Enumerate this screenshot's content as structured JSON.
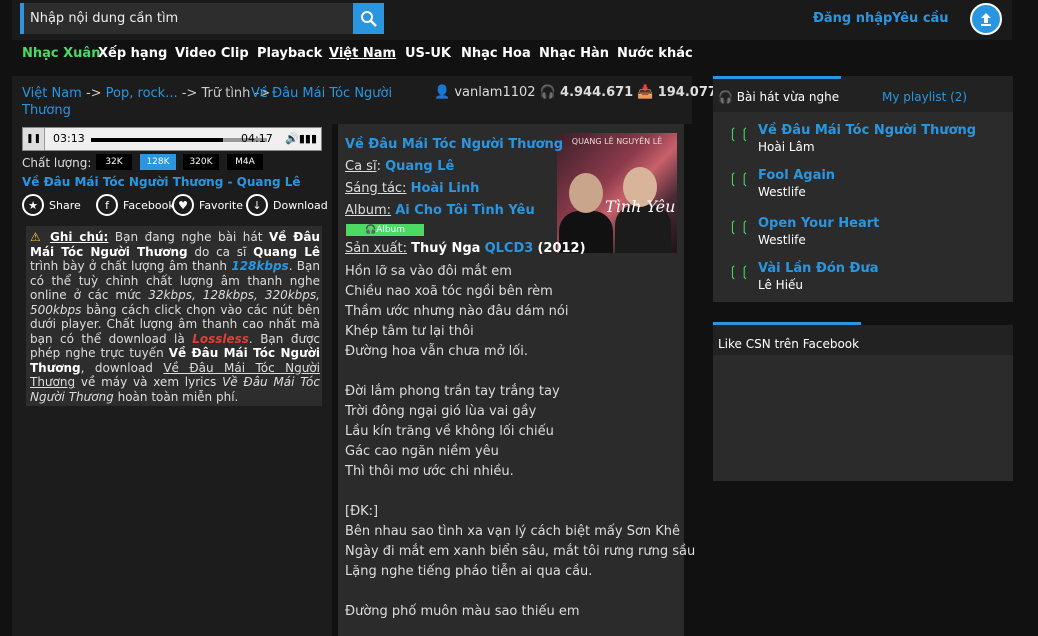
{
  "search": {
    "placeholder": "Nhập nội dung cần tìm"
  },
  "header": {
    "login": "Đăng nhập",
    "signup": "Yêu cầu"
  },
  "nav": [
    {
      "label": "Nhạc Xuân"
    },
    {
      "label": "Xếp hạng"
    },
    {
      "label": "Video Clip"
    },
    {
      "label": "Playback"
    },
    {
      "label": "Việt Nam"
    },
    {
      "label": "US-UK"
    },
    {
      "label": "Nhạc Hoa"
    },
    {
      "label": "Nhạc Hàn"
    },
    {
      "label": "Nước khác"
    }
  ],
  "breadcrumb": {
    "root": "Việt Nam",
    "sep": " -> ",
    "genre": "Pop, rock...",
    "sub": "Trữ tình",
    "song": "Về Đâu Mái Tóc Người Thương"
  },
  "stats": {
    "uploader": "vanlam1102",
    "listens": "4.944.671",
    "downloads": "194.077"
  },
  "player": {
    "current": "03:13",
    "duration": "04:17",
    "progress": 0.75
  },
  "quality": {
    "label": "Chất lượng:",
    "options": [
      "32K",
      "128K",
      "320K",
      "M4A"
    ]
  },
  "song_title_link": "Về Đâu Mái Tóc Người Thương - Quang Lê",
  "share": {
    "share": "Share",
    "facebook": "Facebook",
    "favorite": "Favorite",
    "download": "Download"
  },
  "note": {
    "heading": "Ghi chú:",
    "t1": " Bạn đang nghe bài hát ",
    "song": "Về Đâu Mái Tóc Người Thương",
    "t2": " do ca sĩ ",
    "artist": "Quang Lê",
    "t3": " trình bày ở chất lượng âm thanh ",
    "kbps": "128kbps",
    "t4": ". Bạn có thể tuỳ chỉnh chất lượng âm thanh nghe online ở các mức ",
    "levels": "32kbps, 128kbps, 320kbps, 500kbps",
    "t5": " bằng cách click chọn vào các nút bên dưới player. Chất lượng âm thanh cao nhất mà bạn có thể download là ",
    "lossless": "Lossless",
    "t6": ". Bạn được phép nghe trực tuyến ",
    "song2": "Về Đâu Mái Tóc Người Thương",
    "t7": ", download ",
    "song3": "Về Đâu Mái Tóc Người Thương",
    "t8": " về máy và xem lyrics ",
    "song4": "Về Đâu Mái Tóc Người Thương",
    "t9": " hoàn toàn miễn phí."
  },
  "meta": {
    "title": "Về Đâu Mái Tóc Người Thương",
    "singer_label": "Ca sĩ",
    "singer": "Quang Lê",
    "composer_label": "Sáng tác:",
    "composer": "Hoài Linh",
    "album_label": "Album:",
    "album": "Ai Cho Tôi Tình Yêu",
    "album_badge": "Album",
    "producer_label": "Sản xuất:",
    "producer": "Thuý Nga",
    "code": "QLCD3",
    "year": "(2012)"
  },
  "album_art": {
    "caption": "QUANG LÊ   NGUYÊN LÊ",
    "script": "Tình Yêu"
  },
  "lyrics": [
    "Hồn lỡ sa vào đôi mắt em",
    "Chiều nao xoã tóc ngồi bên rèm",
    "Thầm ước nhưng nào đâu dám nói",
    "Khép tâm tư lại thôi",
    "Đường hoa vẫn chưa mở lối.",
    "",
    "Đời lắm phong trần tay trắng tay",
    "Trời đông ngại gió lùa vai gầy",
    "Lầu kín trăng về không lối chiếu",
    "Gác cao ngăn niềm yêu",
    "Thì thôi mơ ước chi nhiều.",
    "",
    "[ĐK:]",
    "Bên nhau sao tình xa vạn lý cách biệt mấy Sơn Khê",
    "Ngày đi mắt em xanh biển sâu, mắt tôi rưng rưng sầu",
    "Lặng nghe tiếng pháo tiễn ai qua cầu.",
    "",
    "Đường phố muôn màu sao thiếu em"
  ],
  "recent": {
    "tab_recent": "Bài hát vừa nghe",
    "tab_playlist": "My playlist (2)",
    "items": [
      {
        "title": "Về Đâu Mái Tóc Người Thương",
        "artist": "Hoài Lâm"
      },
      {
        "title": "Fool Again",
        "artist": "Westlife"
      },
      {
        "title": "Open Your Heart",
        "artist": "Westlife"
      },
      {
        "title": "Vài Lần Đón Đưa",
        "artist": "Lê Hiếu"
      }
    ]
  },
  "facebook_box": {
    "title": "Like CSN trên Facebook"
  },
  "colors": {
    "accent": "#2a96e0",
    "green": "#4cd964",
    "red": "#e43b3b",
    "bg": "#111111"
  }
}
